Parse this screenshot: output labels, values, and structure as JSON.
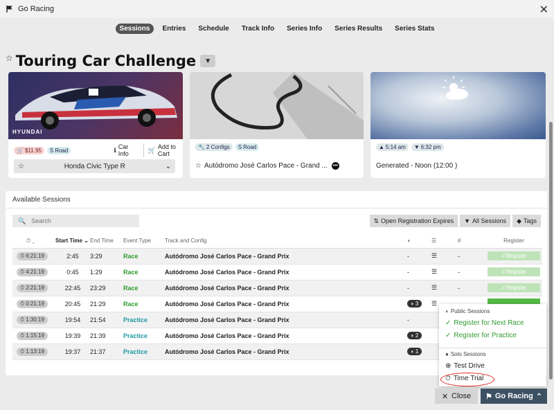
{
  "window": {
    "title": "Go Racing"
  },
  "nav": {
    "tabs": [
      {
        "label": "Sessions"
      },
      {
        "label": "Entries"
      },
      {
        "label": "Schedule"
      },
      {
        "label": "Track Info"
      },
      {
        "label": "Series Info"
      },
      {
        "label": "Series Results"
      },
      {
        "label": "Series Stats"
      }
    ],
    "active": "Sessions"
  },
  "series": {
    "title": "Touring Car Challenge"
  },
  "car_card": {
    "price": "$11.95",
    "type": "Road",
    "info": "Car Info",
    "cart": "Add to Cart",
    "car_name": "Honda Civic Type R",
    "logo": "HYUNDAI"
  },
  "track_card": {
    "configs": "2 Configs",
    "type": "Road",
    "track_name": "Autódromo José Carlos Pace - Grand ..."
  },
  "weather_card": {
    "sunrise": "5:14 am",
    "sunset": "6:32 pm",
    "desc": "Generated - Noon (12:00 )"
  },
  "sessions": {
    "header": "Available Sessions",
    "search_placeholder": "Search",
    "filters": {
      "open_reg": "Open Registration Expires",
      "all": "All Sessions",
      "tags": "Tags"
    },
    "columns": {
      "start": "Start Time",
      "end": "End Time",
      "event": "Event Type",
      "track": "Track and Config",
      "hash": "#",
      "register": "Register"
    },
    "rows": [
      {
        "timer": "6:21:19",
        "start": "2:45",
        "end": "3:29",
        "event": "Race",
        "track": "Autódromo José Carlos Pace - Grand Prix",
        "drivers": "-",
        "hash": "-",
        "reg": "Register"
      },
      {
        "timer": "4:21:19",
        "start": "0:45",
        "end": "1:29",
        "event": "Race",
        "track": "Autódromo José Carlos Pace - Grand Prix",
        "drivers": "-",
        "hash": "-",
        "reg": "Register"
      },
      {
        "timer": "2:21:19",
        "start": "22:45",
        "end": "23:29",
        "event": "Race",
        "track": "Autódromo José Carlos Pace - Grand Prix",
        "drivers": "-",
        "hash": "-",
        "reg": "Register"
      },
      {
        "timer": "0:21:19",
        "start": "20:45",
        "end": "21:29",
        "event": "Race",
        "track": "Autódromo José Carlos Pace - Grand Prix",
        "drivers": "3",
        "hash": "",
        "reg": ""
      },
      {
        "timer": "1:30:19",
        "start": "19:54",
        "end": "21:54",
        "event": "Practice",
        "track": "Autódromo José Carlos Pace - Grand Prix",
        "drivers": "-",
        "hash": "",
        "reg": ""
      },
      {
        "timer": "1:15:19",
        "start": "19:39",
        "end": "21:39",
        "event": "Practice",
        "track": "Autódromo José Carlos Pace - Grand Prix",
        "drivers": "2",
        "hash": "",
        "reg": ""
      },
      {
        "timer": "1:13:19",
        "start": "19:37",
        "end": "21:37",
        "event": "Practice",
        "track": "Autódromo José Carlos Pace - Grand Prix",
        "drivers": "1",
        "hash": "",
        "reg": ""
      }
    ]
  },
  "dropdown": {
    "public_header": "Public Sessions",
    "next_race": "Register for Next Race",
    "practice": "Register for Practice",
    "solo_header": "Solo Sessions",
    "test_drive": "Test Drive",
    "time_trial": "Time Trial"
  },
  "buttons": {
    "close": "Close",
    "go": "Go Racing"
  },
  "colors": {
    "green": "#2f9a2f",
    "teal": "#1f9aa0",
    "go_btn": "#3c5163"
  }
}
